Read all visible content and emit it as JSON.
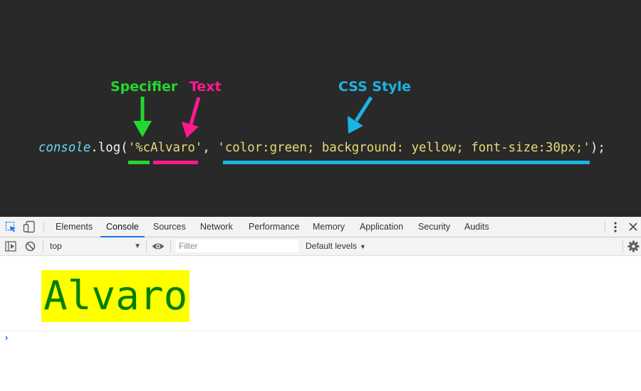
{
  "annotation": {
    "specifier_label": "Specifier",
    "text_label": "Text",
    "css_label": "CSS Style",
    "colors": {
      "specifier": "#23d82e",
      "text": "#ff1a8c",
      "css": "#1bb4e5",
      "background": "#292929"
    }
  },
  "code": {
    "object": "console",
    "dot": ".",
    "method": "log",
    "open": "(",
    "format_string": "'%cAlvaro'",
    "comma": ", ",
    "style_string": "'color:green; background: yellow; font-size:30px;'",
    "close": ");"
  },
  "devtools": {
    "tabs": [
      {
        "label": "Elements",
        "active": false
      },
      {
        "label": "Console",
        "active": true
      },
      {
        "label": "Sources",
        "active": false
      },
      {
        "label": "Network",
        "active": false
      },
      {
        "label": "Performance",
        "active": false
      },
      {
        "label": "Memory",
        "active": false
      },
      {
        "label": "Application",
        "active": false
      },
      {
        "label": "Security",
        "active": false
      },
      {
        "label": "Audits",
        "active": false
      }
    ],
    "icons": {
      "inspect": "inspect-element-icon",
      "device": "device-toolbar-icon",
      "more": "more-vertical-icon",
      "close": "close-icon",
      "sidebar": "show-sidebar-icon",
      "clear": "clear-console-icon",
      "eye": "live-expression-icon",
      "settings": "gear-icon",
      "prompt": "chevron-right-icon"
    },
    "toolbar": {
      "context": "top",
      "filter_placeholder": "Filter",
      "levels": "Default levels"
    },
    "console_output": {
      "text": "Alvaro",
      "color": "#008000",
      "background": "#ffff00"
    },
    "prompt": "›"
  }
}
